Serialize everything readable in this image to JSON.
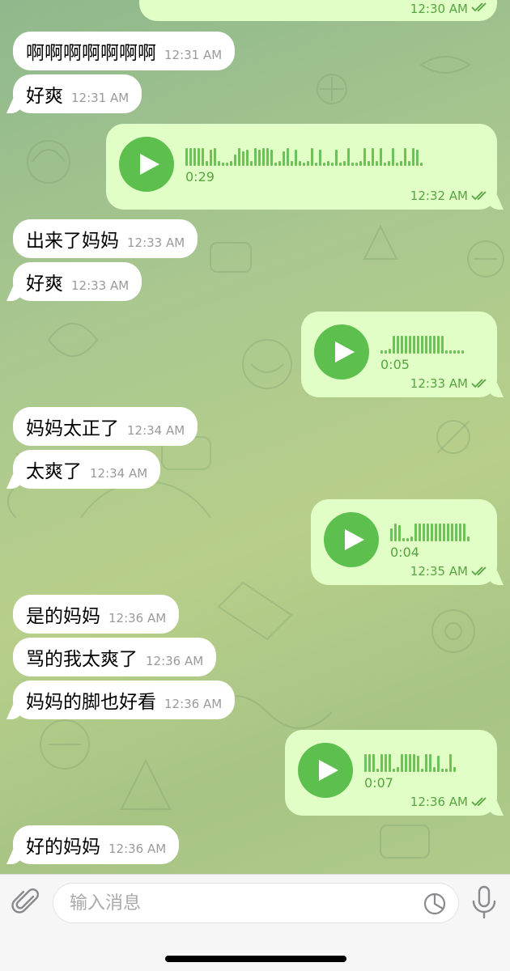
{
  "chat": {
    "top_partial": {
      "time": "12:30 AM"
    },
    "messages": [
      {
        "type": "text",
        "dir": "in",
        "text": "啊啊啊啊啊啊啊",
        "time": "12:31 AM"
      },
      {
        "type": "text",
        "dir": "in",
        "text": "好爽",
        "time": "12:31 AM"
      },
      {
        "type": "voice",
        "dir": "out",
        "duration": "0:29",
        "time": "12:32 AM"
      },
      {
        "type": "text",
        "dir": "in",
        "text": "出来了妈妈",
        "time": "12:33 AM"
      },
      {
        "type": "text",
        "dir": "in",
        "text": "好爽",
        "time": "12:33 AM"
      },
      {
        "type": "voice",
        "dir": "out",
        "duration": "0:05",
        "time": "12:33 AM"
      },
      {
        "type": "text",
        "dir": "in",
        "text": "妈妈太正了",
        "time": "12:34 AM"
      },
      {
        "type": "text",
        "dir": "in",
        "text": "太爽了",
        "time": "12:34 AM"
      },
      {
        "type": "voice",
        "dir": "out",
        "duration": "0:04",
        "time": "12:35 AM"
      },
      {
        "type": "text",
        "dir": "in",
        "text": "是的妈妈",
        "time": "12:36 AM"
      },
      {
        "type": "text",
        "dir": "in",
        "text": "骂的我太爽了",
        "time": "12:36 AM"
      },
      {
        "type": "text",
        "dir": "in",
        "text": "妈妈的脚也好看",
        "time": "12:36 AM"
      },
      {
        "type": "voice",
        "dir": "out",
        "duration": "0:07",
        "time": "12:36 AM"
      },
      {
        "type": "text",
        "dir": "in",
        "text": "好的妈妈",
        "time": "12:36 AM"
      }
    ]
  },
  "input": {
    "placeholder": "输入消息"
  },
  "icons": [
    "attach-icon",
    "play-icon",
    "read-checkmarks-icon",
    "sticker-icon",
    "microphone-icon"
  ],
  "colors": {
    "incoming_bubble": "#ffffff",
    "outgoing_bubble": "#e1fec6",
    "accent_green": "#5dbf4d",
    "outgoing_meta": "#55a63f"
  }
}
